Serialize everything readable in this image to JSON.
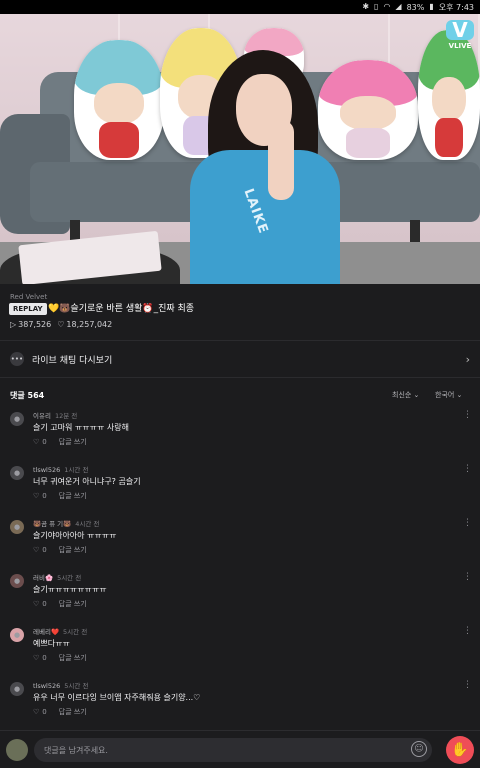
{
  "status_bar": {
    "battery": "83%",
    "time": "오후 7:43",
    "icons": [
      "bluetooth-icon",
      "vibrate-icon",
      "wifi-icon",
      "signal-icon",
      "battery-icon"
    ]
  },
  "video": {
    "logo_text": "VLIVE",
    "logo_mark": "V",
    "sleeve_text": "LAIKE"
  },
  "info": {
    "channel": "Red Velvet",
    "badge": "REPLAY",
    "title": "💛🐻슬기로운 바른 생활⏰_진짜 최종",
    "plays": "387,526",
    "likes": "18,257,042"
  },
  "chat_replay": {
    "label": "라이브 채팅 다시보기"
  },
  "comments_header": {
    "title": "댓글 564",
    "sort": "최신순 ⌄",
    "language": "한국어 ⌄"
  },
  "comments": [
    {
      "author": "이유리",
      "time": "12분 전",
      "text": "슬기 고마워 ㅠㅠㅠㅠ 사랑해",
      "likes": "0",
      "reply": "답글 쓰기"
    },
    {
      "author": "tlswl526",
      "time": "1시간 전",
      "text": "너무 귀여운거 아니냐구? 곰슬기",
      "likes": "0",
      "reply": "답글 쓰기"
    },
    {
      "author": "🐻곰 퓨 기🐻",
      "time": "4시간 전",
      "text": "슬기야아아아아 ㅠㅠㅠㅠ",
      "likes": "0",
      "reply": "답글 쓰기"
    },
    {
      "author": "러비🌸",
      "time": "5시간 전",
      "text": "슬기ㅠㅠㅠㅠㅠㅠㅠㅠ",
      "likes": "0",
      "reply": "답글 쓰기"
    },
    {
      "author": "레베리❤️",
      "time": "5시간 전",
      "text": "예쁘다ㅠㅠ",
      "likes": "0",
      "reply": "답글 쓰기"
    },
    {
      "author": "tlswl526",
      "time": "5시간 전",
      "text": "유우 너무 이르다잉 브이앱 자주해줘용 슬기양...♡",
      "likes": "0",
      "reply": "답글 쓰기"
    }
  ],
  "input": {
    "placeholder": "댓글을 남겨주세요."
  }
}
